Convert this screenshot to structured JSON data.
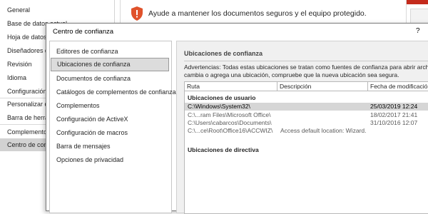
{
  "background": {
    "nav_items": [
      {
        "label": "General"
      },
      {
        "label": "Base de datos actual"
      },
      {
        "label": "Hoja de datos"
      },
      {
        "label": "Diseñadores de objetos"
      },
      {
        "label": "Revisión"
      },
      {
        "label": "Idioma"
      },
      {
        "label": "Configuración de cliente"
      },
      {
        "label": "Personalizar cinta de opciones"
      },
      {
        "label": "Barra de herramientas de acceso rápido"
      },
      {
        "label": "Complementos"
      },
      {
        "label": "Centro de confianza"
      }
    ],
    "selected_index": 10,
    "header_text": "Ayude a mantener los documentos seguros y el equipo protegido."
  },
  "dialog": {
    "title": "Centro de confianza",
    "help": "?",
    "nav": [
      "Editores de confianza",
      "Ubicaciones de confianza",
      "Documentos de confianza",
      "Catálogos de complementos de confianza",
      "Complementos",
      "Configuración de ActiveX",
      "Configuración de macros",
      "Barra de mensajes",
      "Opciones de privacidad"
    ],
    "nav_selected_index": 1,
    "content": {
      "section_title": "Ubicaciones de confianza",
      "warning_line1": "Advertencias: Todas estas ubicaciones se tratan como fuentes de confianza para abrir archivos. Si",
      "warning_line2": "cambia o agrega una ubicación, compruebe que la nueva ubicación sea segura.",
      "columns": [
        "Ruta",
        "Descripción",
        "Fecha de modificación"
      ],
      "user_group": "Ubicaciones de usuario",
      "rows": [
        {
          "path": "C:\\Windows\\System32\\",
          "description": "",
          "date": "25/03/2019 12:24"
        },
        {
          "path": "C:\\...ram Files\\Microsoft Office\\",
          "description": "",
          "date": "18/02/2017 21:41"
        },
        {
          "path": "C:\\Users\\cabarcos\\Documents\\",
          "description": "",
          "date": "31/10/2016 12:07"
        },
        {
          "path": "C:\\...ce\\Root\\Office16\\ACCWIZ\\",
          "description": "Access default location: Wizard...",
          "date": ""
        }
      ],
      "selected_row_index": 0,
      "policy_group": "Ubicaciones de directiva"
    }
  },
  "colors": {
    "selection": "#d6d6d6",
    "shield": "#e0522b",
    "window_close": "#c42b1c"
  },
  "icons": {
    "shield": "shield-icon"
  }
}
